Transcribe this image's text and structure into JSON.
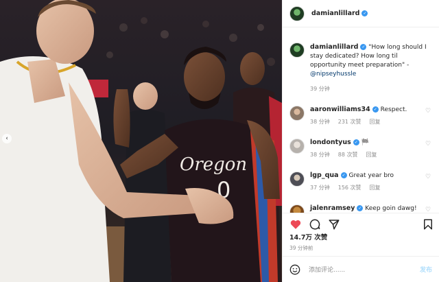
{
  "header": {
    "username": "damianlillard",
    "verified_icon": "verified-badge-icon"
  },
  "caption": {
    "username": "damianlillard",
    "text": "\"How long should I stay dedicated? How long til opportunity meet preparation\" - ",
    "mention": "@nipseyhussle",
    "time": "39 分钟"
  },
  "comments": [
    {
      "username": "aaronwilliams34",
      "text": "Respect.",
      "time": "38 分钟",
      "likes": "231 次赞",
      "reply": "回复"
    },
    {
      "username": "londontyus",
      "text": "🏁",
      "time": "38 分钟",
      "likes": "88 次赞",
      "reply": "回复"
    },
    {
      "username": "lgp_qua",
      "text": "Great year bro",
      "time": "37 分钟",
      "likes": "156 次赞",
      "reply": "回复"
    },
    {
      "username": "jalenramsey",
      "text": "Keep goin dawg!",
      "time": "",
      "likes": "",
      "reply": ""
    }
  ],
  "engagement": {
    "likes": "14.7万 次赞",
    "time_ago": "39 分钟前"
  },
  "comment_box": {
    "placeholder": "添加评论......",
    "post_label": "发布"
  },
  "photo": {
    "jersey_text": "Oregon",
    "jersey_number": "0"
  },
  "colors": {
    "verified": "#3897f0",
    "like_red": "#ed4956",
    "link": "#00376b"
  }
}
